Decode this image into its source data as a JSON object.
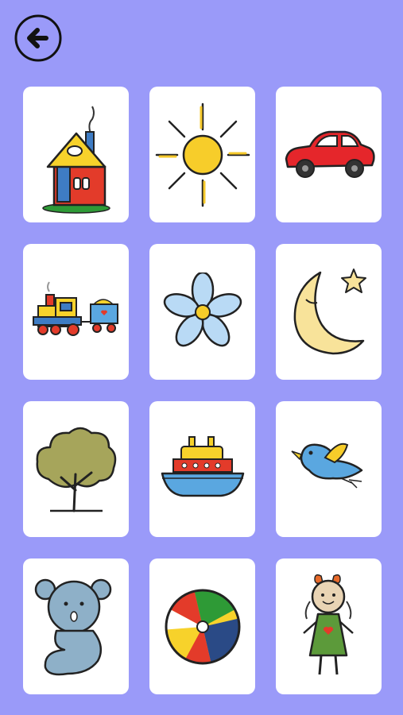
{
  "toolbar": {
    "back_icon": "back-arrow-icon"
  },
  "colors": {
    "background": "#9a9af9",
    "card": "#ffffff"
  },
  "cards": [
    {
      "icon": "house-icon"
    },
    {
      "icon": "sun-icon"
    },
    {
      "icon": "car-icon"
    },
    {
      "icon": "train-icon"
    },
    {
      "icon": "flower-icon"
    },
    {
      "icon": "moon-star-icon"
    },
    {
      "icon": "tree-icon"
    },
    {
      "icon": "boat-icon"
    },
    {
      "icon": "bird-icon"
    },
    {
      "icon": "teddy-bear-icon"
    },
    {
      "icon": "beach-ball-icon"
    },
    {
      "icon": "doll-icon"
    }
  ]
}
